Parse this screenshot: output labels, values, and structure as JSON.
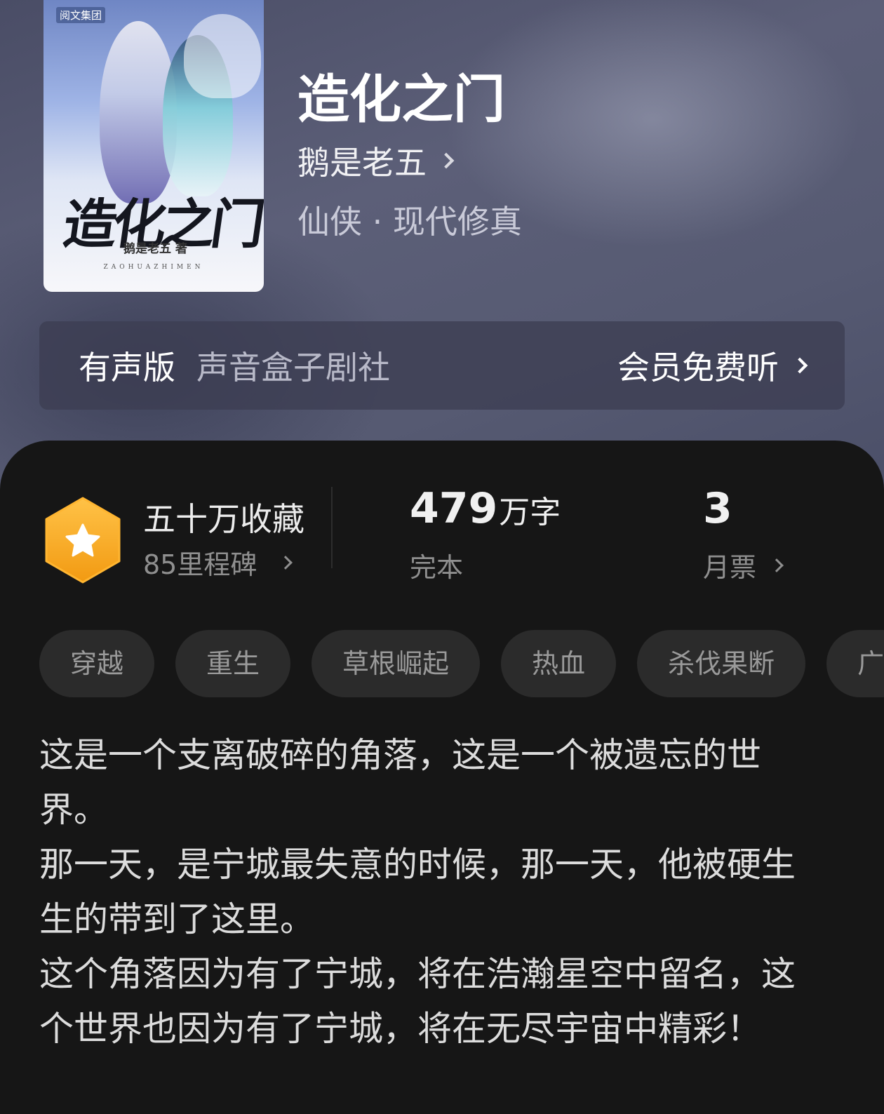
{
  "book": {
    "title": "造化之门",
    "author": "鹅是老五",
    "genre": "仙侠 · 现代修真"
  },
  "cover": {
    "publisher": "阅文集团",
    "title": "造化之门",
    "author_line": "鹅是老五 著",
    "pinyin": "ZAOHUAZHIMEN"
  },
  "audio": {
    "label": "有声版",
    "source": "声音盒子剧社",
    "cta": "会员免费听"
  },
  "stats": {
    "favorites": "五十万收藏",
    "milestones": "85里程碑",
    "word_count": "479",
    "word_unit": "万字",
    "status": "完本",
    "monthly_votes": "3",
    "monthly_votes_label": "月票"
  },
  "tags": [
    "穿越",
    "重生",
    "草根崛起",
    "热血",
    "杀伐果断",
    "广"
  ],
  "synopsis": [
    "这是一个支离破碎的角落，这是一个被遗忘的世界。",
    "那一天，是宁城最失意的时候，那一天，他被硬生生的带到了这里。",
    "这个角落因为有了宁城，将在浩瀚星空中留名，这个世界也因为有了宁城，将在无尽宇宙中精彩！"
  ],
  "colors": {
    "badge": "#f5a623",
    "sheet_bg": "#161616",
    "tag_bg": "#2b2b2b"
  }
}
